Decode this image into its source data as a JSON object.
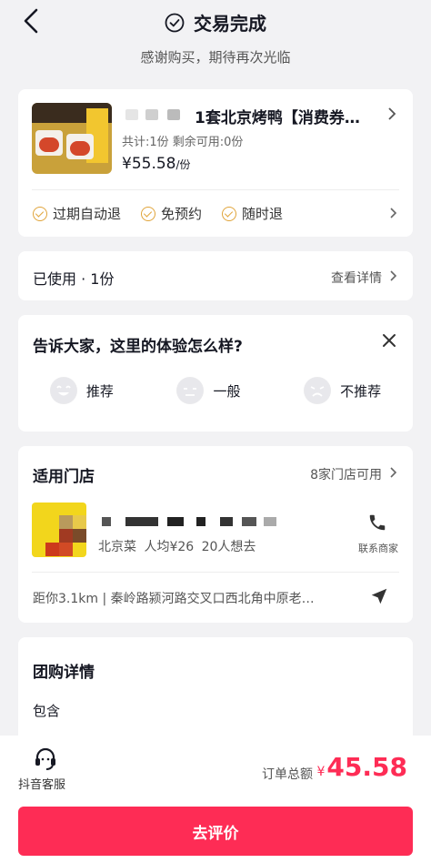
{
  "header": {
    "title": "交易完成",
    "subtitle": "感谢购买，期待再次光临"
  },
  "product": {
    "name": "1套北京烤鸭【消费券…",
    "info": "共计:1份  剩余可用:0份",
    "price": "¥55.58",
    "price_unit": "/份",
    "tags": [
      "过期自动退",
      "免预约",
      "随时退"
    ]
  },
  "usage": {
    "text": "已使用 · 1份",
    "link": "查看详情"
  },
  "review": {
    "question": "告诉大家，这里的体验怎么样?",
    "options": [
      "推荐",
      "一般",
      "不推荐"
    ]
  },
  "store": {
    "title": "适用门店",
    "count": "8家门店可用",
    "meta": "北京菜  人均¥26  20人想去",
    "contact": "联系商家",
    "address": "距你3.1km | 秦岭路颍河路交叉口西北角中原老…"
  },
  "group": {
    "title": "团购详情",
    "include": "包含"
  },
  "bottom": {
    "service": "抖音客服",
    "total_label": "订单总额",
    "currency": "¥",
    "total": "45.58",
    "cta": "去评价"
  },
  "colors": {
    "accent": "#fe2c55",
    "tag": "#e0a43a"
  }
}
